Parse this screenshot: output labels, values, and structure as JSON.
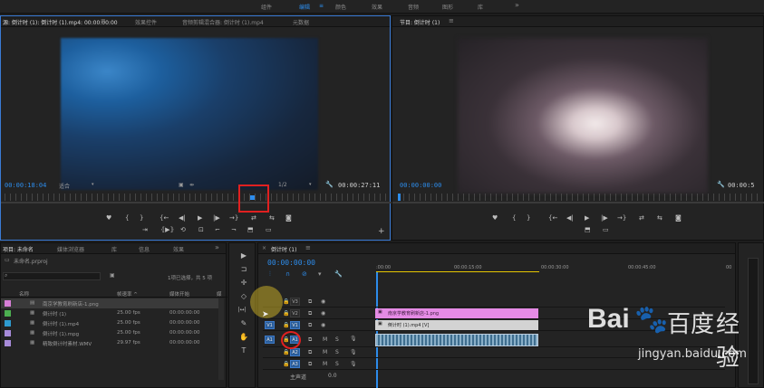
{
  "workspaces": [
    "组件",
    "编辑",
    "颜色",
    "效果",
    "音频",
    "图形",
    "库"
  ],
  "workspace_more": "»",
  "workspace_menu": "≡",
  "source_panel": {
    "tabs": [
      "源: 倒计时 (1): 倒计时 (1).mp4: 00:00:00:00",
      "效果控件",
      "音频剪辑混合器: 倒计时 (1).mp4",
      "元数据"
    ],
    "tab_menu": "≡",
    "timecode_current": "00:00:18:04",
    "fit": "适合",
    "resolution": "1/2",
    "timecode_duration": "00:00:27:11"
  },
  "program_panel": {
    "tab": "节目: 倒计时 (1)",
    "tab_menu": "≡",
    "timecode_current": "00:00:00:00",
    "timecode_duration": "00:00:5"
  },
  "transport_icons": [
    "♥",
    "{",
    "}",
    "{←",
    "◀|",
    "▶",
    "|▶",
    "→}",
    "⇄",
    "⇆",
    "◙"
  ],
  "project_panel": {
    "tabs": [
      "项目: 未命名",
      "媒体浏览器",
      "库",
      "信息",
      "效果"
    ],
    "tab_more": "»",
    "file": "未命名.prproj",
    "selection_info": "1项已选择，共 5 项",
    "columns": [
      "名称",
      "帧速率 ^",
      "媒体开始",
      "媒"
    ],
    "items": [
      {
        "name": "南京学教育刷新店-1.png",
        "fps": "",
        "start": "",
        "color": "#d77ed7"
      },
      {
        "name": "倒计时 (1)",
        "fps": "25.00 fps",
        "start": "00:00:00:00",
        "color": "#4caf50"
      },
      {
        "name": "倒计时 (1).mp4",
        "fps": "25.00 fps",
        "start": "00:00:00:00",
        "color": "#2e9bcf"
      },
      {
        "name": "倒计时 (1).mpg",
        "fps": "25.00 fps",
        "start": "00:00:00:00",
        "color": "#a78bd9"
      },
      {
        "name": "精致倒计时素材.WMV",
        "fps": "29.97 fps",
        "start": "00:00:00:00",
        "color": "#a78bd9"
      }
    ]
  },
  "timeline": {
    "tab": "倒计时 (1)",
    "tab_menu": "≡",
    "close": "×",
    "timecode": "00:00:00:00",
    "ruler_labels": [
      ":00:00",
      "00:00:15:00",
      "00:00:30:00",
      "00:00:45:00",
      "00"
    ],
    "tracks": [
      {
        "name": "V3",
        "src": ""
      },
      {
        "name": "V2",
        "src": ""
      },
      {
        "name": "V1",
        "src": "V1"
      },
      {
        "name": "A1",
        "src": "A1"
      },
      {
        "name": "A2",
        "src": ""
      },
      {
        "name": "A3",
        "src": ""
      }
    ],
    "track_buttons": {
      "mute": "M",
      "solo": "S"
    },
    "master": "主声道",
    "master_value": "0.0",
    "clips": [
      {
        "label": "南京学教育刷新店-1.png",
        "color": "#e58be5"
      },
      {
        "label": "倒计时 (1).mp4 [V]",
        "color": "#cfcfcf"
      }
    ]
  },
  "tools": [
    "▶",
    "⊐",
    "✛",
    "◇",
    "|↔|",
    "✎",
    "✋",
    "T"
  ],
  "watermark": {
    "brand": "Bai",
    "brand2": "百度",
    "suffix": "经验",
    "url": "jingyan.baidu.com"
  }
}
